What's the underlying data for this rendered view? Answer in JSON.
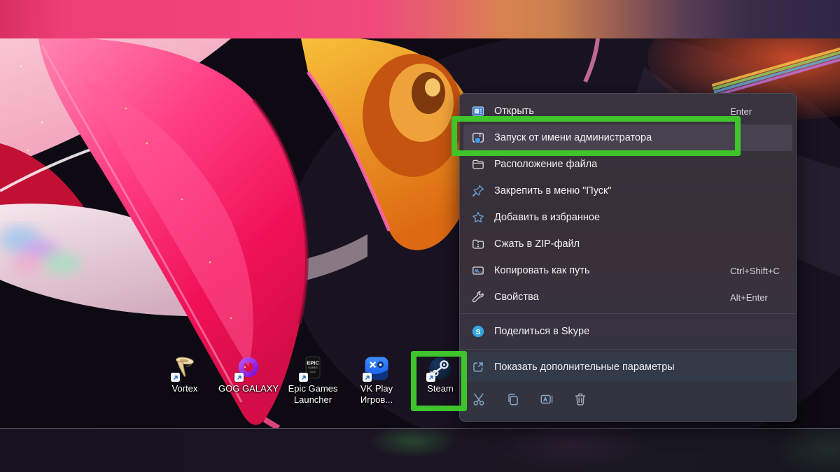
{
  "colors": {
    "annotation_green": "#3fc42c",
    "menu_background": "#39343f",
    "menu_highlight": "#474150",
    "accent_blue": "#4fa3e3"
  },
  "desktop": {
    "icons": [
      {
        "name": "vortex",
        "icon": "vortex-icon",
        "line1": "Vortex",
        "line2": ""
      },
      {
        "name": "gog-galaxy",
        "icon": "gog-galaxy-icon",
        "line1": "GOG GALAXY",
        "line2": ""
      },
      {
        "name": "epic-games-launcher",
        "icon": "epic-games-icon",
        "line1": "Epic Games",
        "line2": "Launcher"
      },
      {
        "name": "vk-play",
        "icon": "vk-play-icon",
        "line1": "VK Play",
        "line2": "Игров..."
      },
      {
        "name": "steam",
        "icon": "steam-icon",
        "line1": "Steam",
        "line2": ""
      }
    ]
  },
  "context_menu": {
    "items": [
      {
        "label": "Открыть",
        "shortcut": "Enter",
        "icon": "open-icon"
      },
      {
        "label": "Запуск от имени администратора",
        "shortcut": "",
        "icon": "run-as-admin-icon",
        "highlighted": true
      },
      {
        "label": "Расположение файла",
        "shortcut": "",
        "icon": "file-location-icon"
      },
      {
        "label": "Закрепить в меню \"Пуск\"",
        "shortcut": "",
        "icon": "pin-icon"
      },
      {
        "label": "Добавить в избранное",
        "shortcut": "",
        "icon": "favorite-star-icon"
      },
      {
        "label": "Сжать в ZIP-файл",
        "shortcut": "",
        "icon": "zip-folder-icon"
      },
      {
        "label": "Копировать как путь",
        "shortcut": "Ctrl+Shift+C",
        "icon": "copy-path-icon"
      },
      {
        "label": "Свойства",
        "shortcut": "Alt+Enter",
        "icon": "properties-wrench-icon"
      },
      {
        "label": "Поделиться в Skype",
        "shortcut": "",
        "icon": "skype-icon"
      },
      {
        "label": "Показать дополнительные параметры",
        "shortcut": "",
        "icon": "show-more-icon"
      }
    ],
    "toolbar": [
      {
        "icon": "cut-icon"
      },
      {
        "icon": "copy-icon"
      },
      {
        "icon": "rename-icon"
      },
      {
        "icon": "delete-icon"
      }
    ]
  }
}
